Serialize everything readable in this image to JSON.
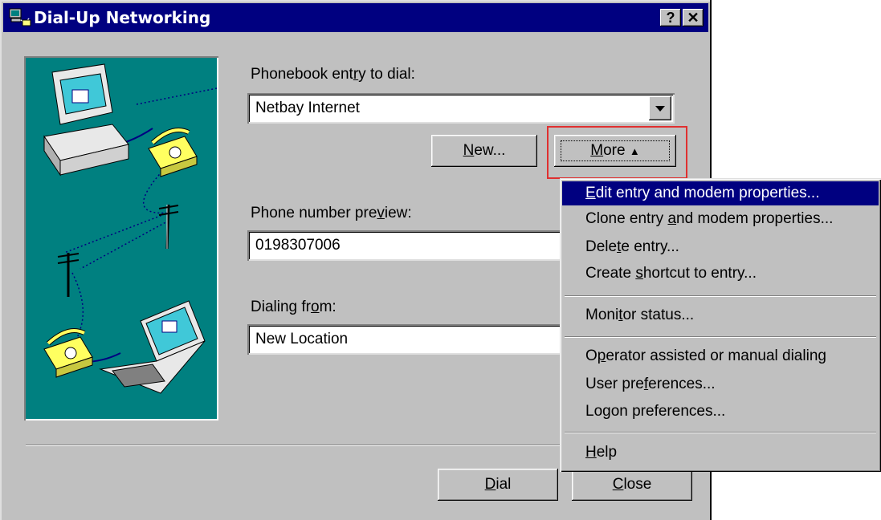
{
  "window": {
    "title": "Dial-Up Networking",
    "help_btn": "?",
    "close_btn": "✕"
  },
  "phonebook": {
    "label_pre": "Phonebook ent",
    "label_ul": "r",
    "label_post": "y to dial:",
    "value": "Netbay Internet"
  },
  "buttons": {
    "new_ul": "N",
    "new_rest": "ew...",
    "more_ul": "M",
    "more_rest": "ore",
    "more_arrow": "▲",
    "dial_ul": "D",
    "dial_rest": "ial",
    "close_ul": "C",
    "close_rest": "lose"
  },
  "phone_preview": {
    "label_pre": "Phone number pre",
    "label_ul": "v",
    "label_post": "iew:",
    "value": "0198307006"
  },
  "dialing_from": {
    "label_pre": "Dialing fr",
    "label_ul": "o",
    "label_post": "m:",
    "value": "New Location"
  },
  "menu": {
    "items": [
      {
        "pre": "",
        "ul": "E",
        "post": "dit entry and modem properties..."
      },
      {
        "pre": "Clone entry ",
        "ul": "a",
        "post": "nd modem properties..."
      },
      {
        "pre": "Dele",
        "ul": "t",
        "post": "e entry..."
      },
      {
        "pre": "Create ",
        "ul": "s",
        "post": "hortcut to entry..."
      },
      {
        "pre": "Moni",
        "ul": "t",
        "post": "or status..."
      },
      {
        "pre": "O",
        "ul": "p",
        "post": "erator assisted or manual dialing"
      },
      {
        "pre": "User pre",
        "ul": "f",
        "post": "erences..."
      },
      {
        "pre": "Logon preferences...",
        "ul": "",
        "post": ""
      },
      {
        "pre": "",
        "ul": "H",
        "post": "elp"
      }
    ]
  },
  "colors": {
    "titlebar": "#000080",
    "face": "#c0c0c0",
    "art_bg": "#008080",
    "highlight": "#000080",
    "annotation": "#e03030"
  },
  "icons": {
    "title": "dialup-networking-icon",
    "illustration": "computer-modem-phone-illustration"
  }
}
